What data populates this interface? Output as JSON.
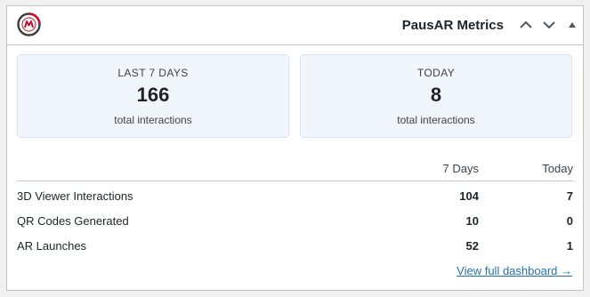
{
  "header": {
    "title": "PausAR Metrics",
    "logo_icon": "pausar-logo-icon",
    "buttons": [
      {
        "icon": "chevron-up-icon",
        "name": "move-up-button"
      },
      {
        "icon": "chevron-down-icon",
        "name": "move-down-button"
      },
      {
        "icon": "triangle-up-icon",
        "name": "collapse-toggle-button"
      }
    ]
  },
  "cards": [
    {
      "label": "LAST 7 DAYS",
      "value": "166",
      "sub": "total interactions"
    },
    {
      "label": "TODAY",
      "value": "8",
      "sub": "total interactions"
    }
  ],
  "table": {
    "columns": [
      "",
      "7 Days",
      "Today"
    ],
    "rows": [
      {
        "name": "3D Viewer Interactions",
        "days7": "104",
        "today": "7"
      },
      {
        "name": "QR Codes Generated",
        "days7": "10",
        "today": "0"
      },
      {
        "name": "AR Launches",
        "days7": "52",
        "today": "1"
      }
    ]
  },
  "footer": {
    "link_label": "View full dashboard →"
  },
  "colors": {
    "card_bg": "#f0f6fc",
    "link": "#2271b1",
    "brand_red": "#c8102e",
    "text": "#1d2327"
  }
}
